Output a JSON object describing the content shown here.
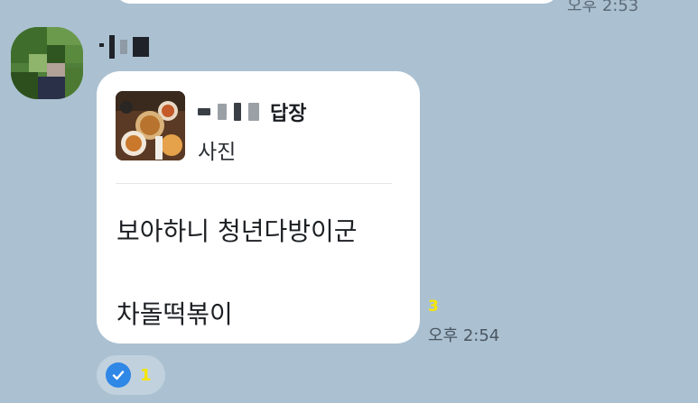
{
  "previous_message": {
    "time": "오후 2:53"
  },
  "sender": {
    "name_censored": true
  },
  "reply": {
    "title_suffix": "답장",
    "subtitle": "사진",
    "thumbnail_icon": "food-photo"
  },
  "message": {
    "line1": "보아하니 청년다방이군",
    "line2": "차돌떡볶이"
  },
  "meta": {
    "unread_count": "3",
    "time": "오후 2:54"
  },
  "reaction": {
    "icon": "check-icon",
    "count": "1"
  },
  "colors": {
    "background": "#abc1d1",
    "bubble": "#ffffff",
    "unread": "#f7e600",
    "check": "#2f87e6"
  }
}
